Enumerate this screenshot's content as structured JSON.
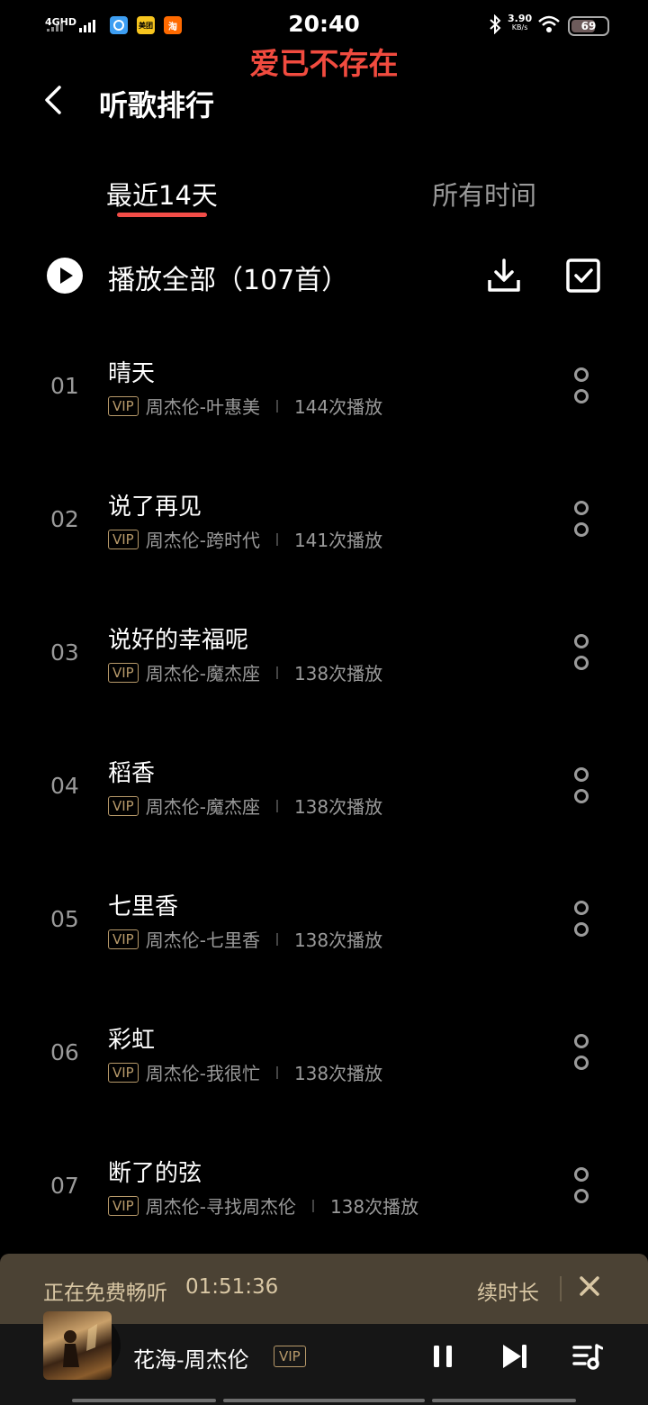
{
  "status_bar": {
    "network_label": "4GHD",
    "time": "20:40",
    "speed_value": "3.90",
    "speed_unit": "KB/s",
    "battery": "69",
    "app_icons": [
      "meituan-icon",
      "taobao-icon",
      "mobile-carrier-icon"
    ],
    "app_badge_meituan": "美团",
    "app_badge_taobao": "淘"
  },
  "overlay_text": "爱已不存在",
  "header": {
    "title": "听歌排行"
  },
  "tabs": [
    {
      "label": "最近14天",
      "active": true
    },
    {
      "label": "所有时间",
      "active": false
    }
  ],
  "play_all": {
    "label": "播放全部（107首）"
  },
  "songs": [
    {
      "rank": "01",
      "title": "晴天",
      "vip": "VIP",
      "artist_album": "周杰伦-叶惠美",
      "plays": "144次播放"
    },
    {
      "rank": "02",
      "title": "说了再见",
      "vip": "VIP",
      "artist_album": "周杰伦-跨时代",
      "plays": "141次播放"
    },
    {
      "rank": "03",
      "title": "说好的幸福呢",
      "vip": "VIP",
      "artist_album": "周杰伦-魔杰座",
      "plays": "138次播放"
    },
    {
      "rank": "04",
      "title": "稻香",
      "vip": "VIP",
      "artist_album": "周杰伦-魔杰座",
      "plays": "138次播放"
    },
    {
      "rank": "05",
      "title": "七里香",
      "vip": "VIP",
      "artist_album": "周杰伦-七里香",
      "plays": "138次播放"
    },
    {
      "rank": "06",
      "title": "彩虹",
      "vip": "VIP",
      "artist_album": "周杰伦-我很忙",
      "plays": "138次播放"
    },
    {
      "rank": "07",
      "title": "断了的弦",
      "vip": "VIP",
      "artist_album": "周杰伦-寻找周杰伦",
      "plays": "138次播放"
    }
  ],
  "trial_bar": {
    "label": "正在免费畅听",
    "remaining": "01:51:36",
    "renew_label": "续时长"
  },
  "player": {
    "now_playing": "花海-周杰伦",
    "vip": "VIP"
  },
  "colors": {
    "accent": "#f24d48",
    "vip_gold": "#b89a6a",
    "trial_bg": "#4b4234",
    "overlay_red": "#f14b3f"
  }
}
